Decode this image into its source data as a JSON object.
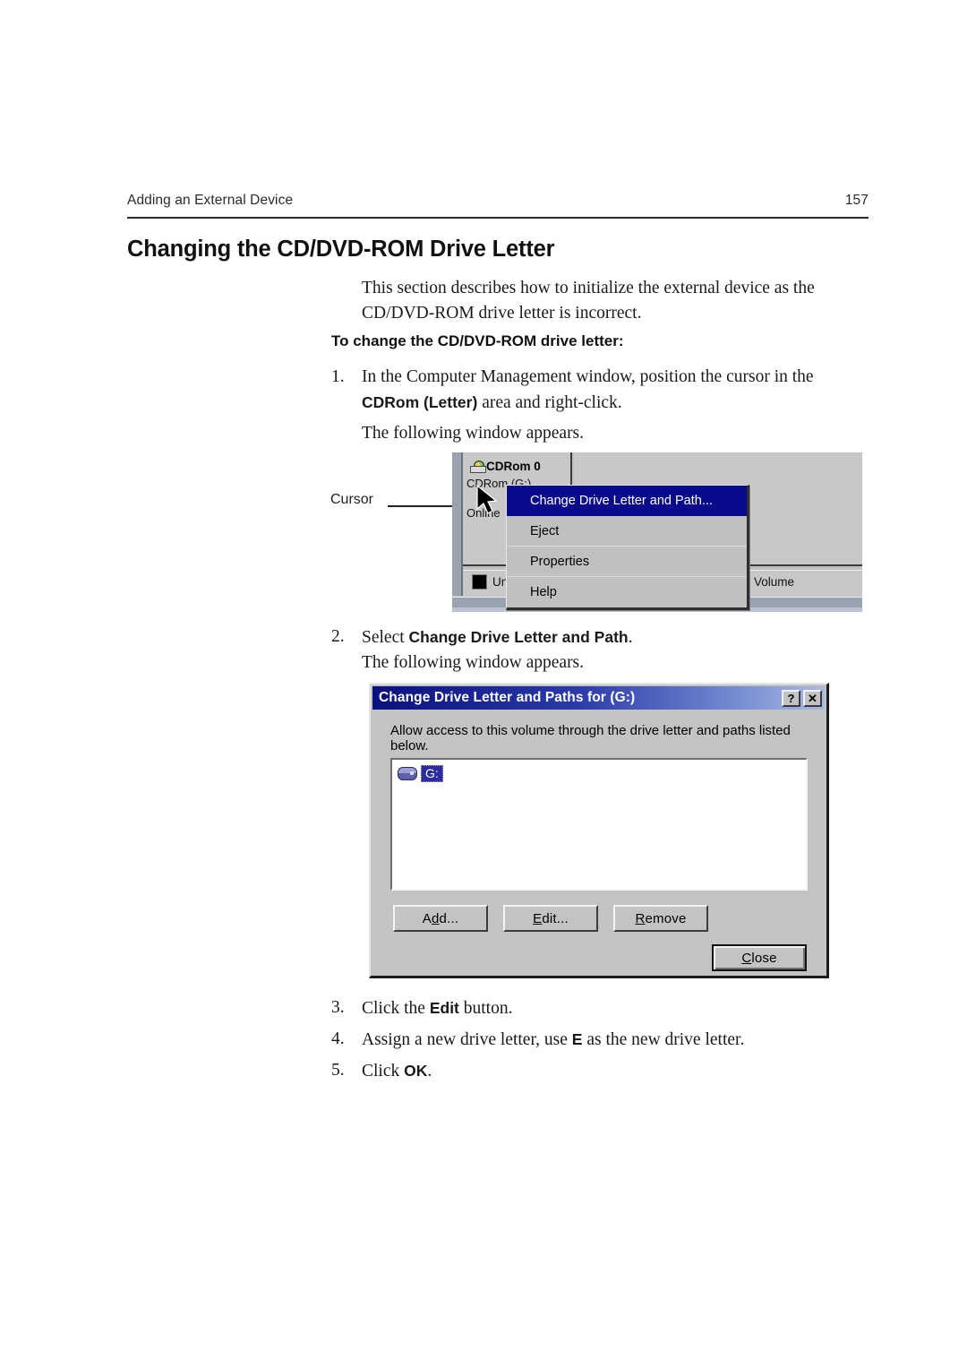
{
  "header": {
    "running_title": "Adding an External Device",
    "page_number": "157"
  },
  "section": {
    "title": "Changing the CD/DVD-ROM Drive Letter",
    "intro": "This section describes how to initialize the external device as the CD/DVD-ROM drive letter is incorrect.",
    "subhead": "To change the CD/DVD-ROM drive letter:"
  },
  "steps": {
    "one": {
      "num": "1.",
      "text_before": "In the Computer Management window, position the cursor in the ",
      "bold": "CDRom (Letter)",
      "text_after": " area and right-click.",
      "note": "The following window appears."
    },
    "two": {
      "num": "2.",
      "text_before": "Select ",
      "bold": "Change Drive Letter and Path",
      "text_after": ".",
      "note": "The following window appears."
    },
    "three": {
      "num": "3.",
      "text_before": "Click the ",
      "bold": "Edit",
      "text_after": " button."
    },
    "four": {
      "num": "4.",
      "text_before": "Assign a new drive letter, use ",
      "bold": "E",
      "text_after": " as the new drive letter."
    },
    "five": {
      "num": "5.",
      "text_before": "Click ",
      "bold": "OK",
      "text_after": "."
    }
  },
  "callout": {
    "cursor_label": "Cursor"
  },
  "figure_computer_management": {
    "disk_title": "CDRom 0",
    "disk_sub": "CDRom (G:)",
    "disk_status": "Online",
    "legend_unallocated": "Un",
    "legend_volume": "Volume",
    "context_menu": [
      {
        "label": "Change Drive Letter and Path...",
        "highlighted": true
      },
      {
        "label": "Eject",
        "highlighted": false
      },
      {
        "label": "Properties",
        "highlighted": false
      },
      {
        "label": "Help",
        "highlighted": false
      }
    ]
  },
  "figure_dialog": {
    "title": "Change Drive Letter and Paths for  (G:)",
    "help_button": "?",
    "close_button": "✕",
    "description": "Allow access to this volume through the drive letter and paths listed below.",
    "list_items": [
      {
        "label": "G:",
        "selected": true
      }
    ],
    "buttons": {
      "add": {
        "pre": "A",
        "accel": "d",
        "post": "d..."
      },
      "edit": {
        "pre": "",
        "accel": "E",
        "post": "dit..."
      },
      "remove": {
        "pre": "",
        "accel": "R",
        "post": "emove"
      },
      "close": {
        "pre": "",
        "accel": "C",
        "post": "lose"
      }
    }
  },
  "colors": {
    "titlebar_start": "#0a117f",
    "titlebar_end": "#aab9e2",
    "menu_highlight": "#0a0a8c",
    "dialog_face": "#c3c3c3"
  }
}
